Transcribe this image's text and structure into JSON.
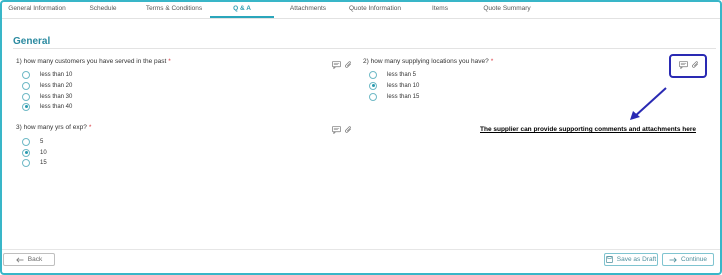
{
  "tabs": [
    {
      "label": "General Information",
      "active": false
    },
    {
      "label": "Schedule",
      "active": false
    },
    {
      "label": "Terms & Conditions",
      "active": false
    },
    {
      "label": "Q & A",
      "active": true
    },
    {
      "label": "Attachments",
      "active": false
    },
    {
      "label": "Quote Information",
      "active": false
    },
    {
      "label": "Items",
      "active": false
    },
    {
      "label": "Quote Summary",
      "active": false
    }
  ],
  "section": {
    "title": "General"
  },
  "questions": [
    {
      "text": "1) how many customers you have served in the past",
      "required_mark": "*",
      "options": [
        {
          "label": "less than 10",
          "selected": false
        },
        {
          "label": "less than 20",
          "selected": false
        },
        {
          "label": "less than 30",
          "selected": false
        },
        {
          "label": "less than 40",
          "selected": true
        }
      ]
    },
    {
      "text": "2) how many supplying locations you have?",
      "required_mark": "*",
      "options": [
        {
          "label": "less than 5",
          "selected": false
        },
        {
          "label": "less than 10",
          "selected": true
        },
        {
          "label": "less than 15",
          "selected": false
        }
      ]
    },
    {
      "text": "3) how many yrs of exp?",
      "required_mark": "*",
      "options": [
        {
          "label": "5",
          "selected": false
        },
        {
          "label": "10",
          "selected": true
        },
        {
          "label": "15",
          "selected": false
        }
      ]
    }
  ],
  "icons": {
    "comment": "comment-icon",
    "attach": "paperclip-icon"
  },
  "annotation": {
    "text": "The supplier can provide supporting comments and attachments here",
    "highlight_color": "#2a2ab3"
  },
  "footer": {
    "back_label": "Back",
    "save_draft_label": "Save as Draft",
    "continue_label": "Continue"
  },
  "colors": {
    "accent": "#2a9bb0",
    "border": "#39b6c8",
    "required": "#d9363e"
  }
}
